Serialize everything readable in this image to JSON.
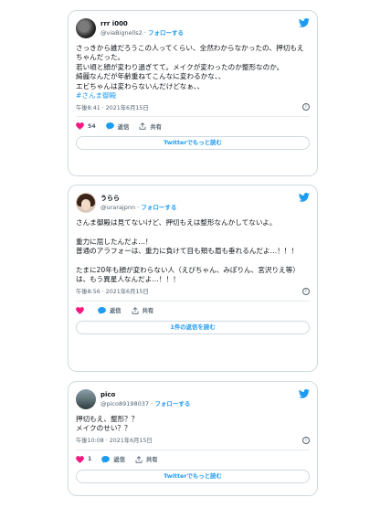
{
  "colors": {
    "accent": "#1d9bf0",
    "heart": "#f91880",
    "text": "#0f1419",
    "muted": "#536471",
    "border": "#cfd9de"
  },
  "tweets": [
    {
      "display_name": "rrr i000",
      "handle": "@viaBignells2",
      "separator": "·",
      "follow": "フォローする",
      "body": "さっきから誰だろうこの人ってくらい、全然わからなかったの、押切もえちゃんだった。\n若い頃と顔が変わり過ぎてて。メイクが変わったのか整形なのか。\n綺麗なんだが年齢重ねてこんなに変わるかな、、\nエビちゃんは変わらないんだけどなぁ、、",
      "hashtag": "#さんま御殿",
      "time": "午後8:41 · 2021年6月15日",
      "like_count": "54",
      "reply_label": "返信",
      "share_label": "共有",
      "button": "Twitterでもっと読む"
    },
    {
      "display_name": "うらら",
      "handle": "@urarajpnn",
      "separator": "·",
      "follow": "フォローする",
      "body": "さんま御殿は見てないけど、押切もえは整形なんかしてないよ。\n\n重力に屈したんだよ…！\n普通のアラフォーは、重力に負けて目も頬も眉も垂れるんだよ…！！！\n\nたまに20年も顔が変わらない人（えびちゃん、みぽりん、宮沢りえ等）は、もう異星人なんだよ…！！！",
      "time": "午後8:56 · 2021年6月15日",
      "reply_label": "返信",
      "share_label": "共有",
      "button": "1件の返信を読む"
    },
    {
      "display_name": "pico",
      "handle": "@pico89198037",
      "separator": "·",
      "follow": "フォローする",
      "body": "押切もえ、整形？？\nメイクのせい？？",
      "time": "午後10:08 · 2021年6月15日",
      "like_count": "1",
      "reply_label": "返信",
      "share_label": "共有",
      "button": "Twitterでもっと読む"
    }
  ]
}
